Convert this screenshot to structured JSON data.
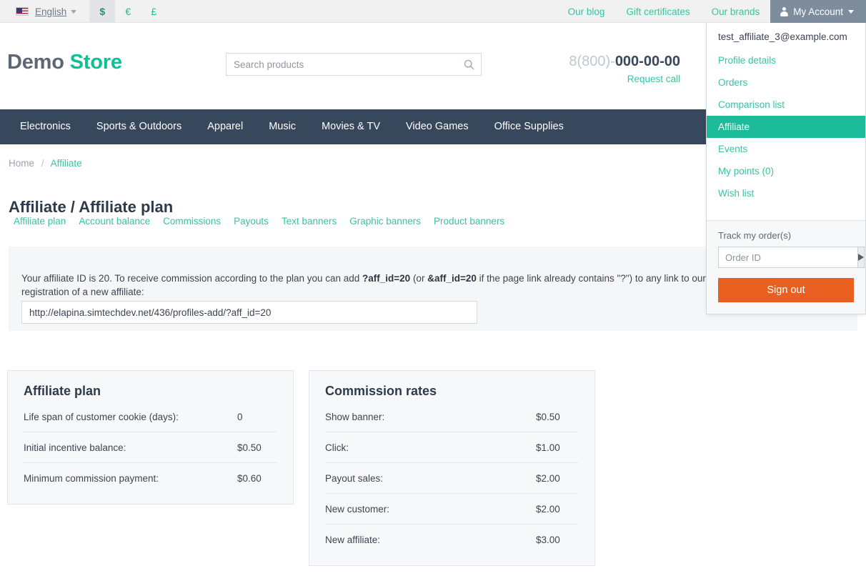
{
  "topbar": {
    "flag_icon": "us-flag-icon",
    "language": "English",
    "currencies": [
      {
        "symbol": "$",
        "selected": true
      },
      {
        "symbol": "€",
        "selected": false
      },
      {
        "symbol": "£",
        "selected": false
      }
    ],
    "links": [
      "Our blog",
      "Gift certificates",
      "Our brands"
    ],
    "account_tab": "My Account",
    "account_icon": "person-icon",
    "caret_icon": "chevron-down-icon"
  },
  "account_menu": {
    "email": "test_affiliate_3@example.com",
    "items": [
      {
        "label": "Profile details",
        "active": false
      },
      {
        "label": "Orders",
        "active": false
      },
      {
        "label": "Comparison list",
        "active": false
      },
      {
        "label": "Affiliate",
        "active": true
      },
      {
        "label": "Events",
        "active": false
      },
      {
        "label": "My points (0)",
        "active": false
      },
      {
        "label": "Wish list",
        "active": false
      }
    ],
    "track_label": "Track my order(s)",
    "track_placeholder": "Order ID",
    "track_value": "",
    "track_go_icon": "play-arrow-icon",
    "signout_label": "Sign out",
    "signout_color": "#e8601f",
    "active_color": "#1cbc9b"
  },
  "header": {
    "logo_part1": "Demo",
    "logo_part2": "Store",
    "search_placeholder": "Search products",
    "search_value": "",
    "search_icon": "search-icon",
    "phone_prefix": "8(800)-",
    "phone_number": "000-00-00",
    "request_call": "Request call"
  },
  "mainnav": {
    "items": [
      "Electronics",
      "Sports & Outdoors",
      "Apparel",
      "Music",
      "Movies & TV",
      "Video Games",
      "Office Supplies"
    ],
    "background": "#37475c"
  },
  "breadcrumb": {
    "home": "Home",
    "separator": "/",
    "current": "Affiliate"
  },
  "page": {
    "title": "Affiliate / Affiliate plan",
    "subtabs": [
      "Affiliate plan",
      "Account balance",
      "Commissions",
      "Payouts",
      "Text banners",
      "Graphic banners",
      "Product banners"
    ]
  },
  "affiliate_info": {
    "text_part1": "Your affiliate ID is 20. To receive commission according to the plan you can add ",
    "code1": "?aff_id=20",
    "text_part2": " (or ",
    "code2": "&aff_id=20",
    "text_part3": " if the page link already contains \"?\") to any link to our store. This is your link for registration of a new affiliate:",
    "url_value": "http://elapina.simtechdev.net/436/profiles-add/?aff_id=20"
  },
  "affiliate_plan_card": {
    "title": "Affiliate plan",
    "rows": [
      {
        "label": "Life span of customer cookie (days):",
        "value": "0"
      },
      {
        "label": "Initial incentive balance:",
        "value": "$0.50"
      },
      {
        "label": "Minimum commission payment:",
        "value": "$0.60"
      }
    ]
  },
  "commission_rates_card": {
    "title": "Commission rates",
    "rows": [
      {
        "label": "Show banner:",
        "value": "$0.50"
      },
      {
        "label": "Click:",
        "value": "$1.00"
      },
      {
        "label": "Payout sales:",
        "value": "$2.00"
      },
      {
        "label": "New customer:",
        "value": "$2.00"
      },
      {
        "label": "New affiliate:",
        "value": "$3.00"
      }
    ]
  }
}
